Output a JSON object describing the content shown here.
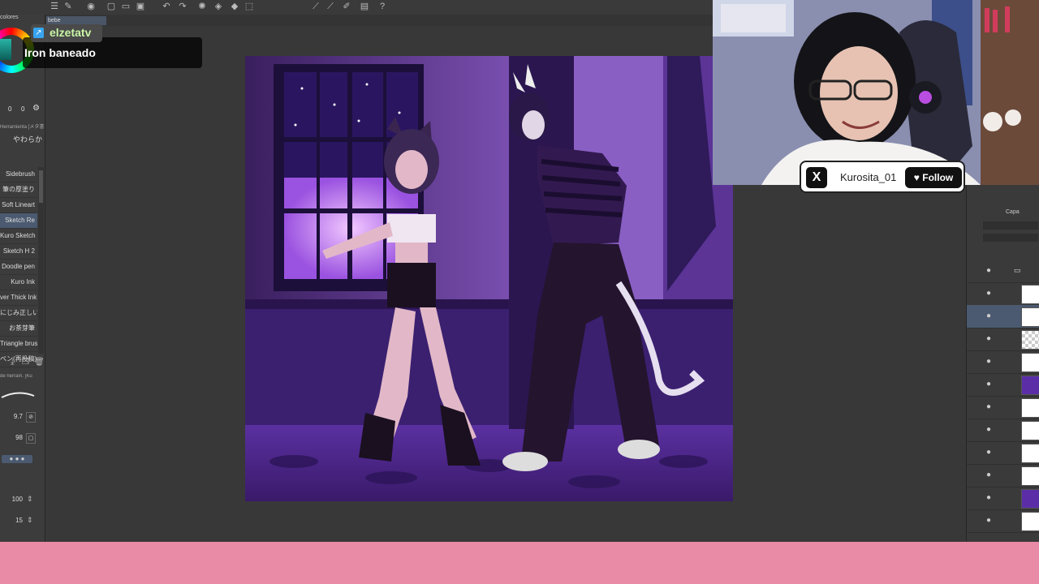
{
  "toolbar": {
    "icons": [
      "menu-icon",
      "pen-icon",
      "eye-icon",
      "new-doc-icon",
      "open-folder-icon",
      "save-icon",
      "undo-icon",
      "redo-icon",
      "spinner-icon",
      "fill-icon",
      "transform-icon",
      "select-icon",
      "ruler-icon",
      "pen-line-icon",
      "layer-icon",
      "help-icon"
    ]
  },
  "tab": {
    "label": "bebe"
  },
  "left_panel": {
    "header": "colores",
    "rgb": [
      "0",
      "0"
    ],
    "tool_header": "Herramienta [メタ書き",
    "tool_sub": "やわらか",
    "brushes": [
      "Sidebrush",
      "筆の厚塗り",
      "Soft Lineart",
      "Sketch Re",
      "Kuro Sketch",
      "Sketch H 2",
      "Doodle pen",
      "Kuro Ink",
      "ver Thick Ink",
      "にじみ正しい",
      "お茶芽筆",
      "Triangle brush",
      "ペン(再投稿)"
    ],
    "selected_brush_index": 3,
    "tool_props": "de herram. [Ku",
    "props": [
      "9.7",
      "98",
      "100",
      "15"
    ]
  },
  "chat": {
    "user": "elzetatv",
    "message": "Iron baneado"
  },
  "social": {
    "username": "Kurosita_01",
    "follow_label": "Follow"
  },
  "layers_panel": {
    "header": "Capa"
  }
}
